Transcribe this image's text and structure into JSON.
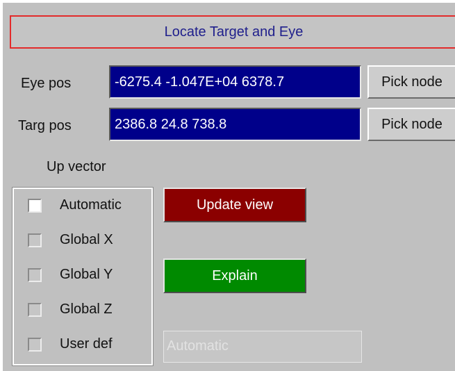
{
  "panel": {
    "title": "Locate Target and Eye"
  },
  "eye": {
    "label": "Eye pos",
    "value": "-6275.4 -1.047E+04 6378.7",
    "pick_label": "Pick node"
  },
  "target": {
    "label": "Targ pos",
    "value": "2386.8 24.8 738.8",
    "pick_label": "Pick node"
  },
  "up_vector": {
    "label": "Up vector",
    "options": [
      {
        "label": "Automatic",
        "selected": true
      },
      {
        "label": "Global X",
        "selected": false
      },
      {
        "label": "Global Y",
        "selected": false
      },
      {
        "label": "Global Z",
        "selected": false
      },
      {
        "label": "User def",
        "selected": false
      }
    ],
    "user_def_value": "Automatic"
  },
  "actions": {
    "update_view": "Update view",
    "explain": "Explain"
  },
  "colors": {
    "panel_bg": "#c0c0c0",
    "title_text": "#1f1f8c",
    "title_border": "#e32a2a",
    "field_bg": "#00008a",
    "update_bg": "#8b0000",
    "explain_bg": "#008a00"
  }
}
